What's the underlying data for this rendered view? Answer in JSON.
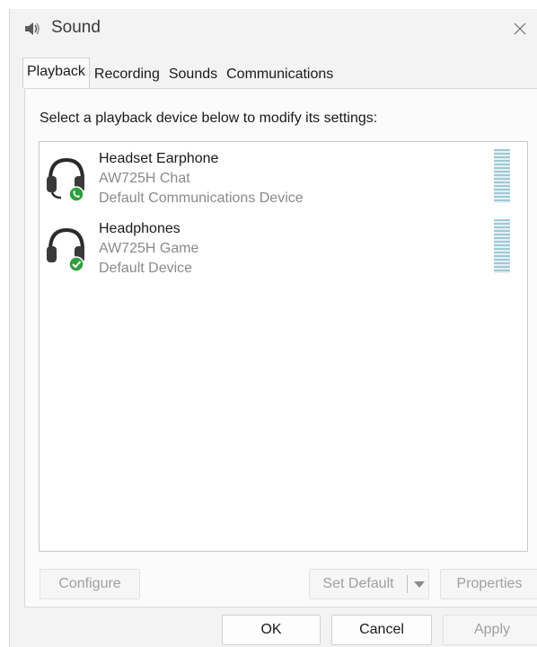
{
  "window": {
    "title": "Sound",
    "icon": "speaker-icon",
    "close_icon": "close-icon"
  },
  "tabs": [
    {
      "label": "Playback",
      "active": true
    },
    {
      "label": "Recording",
      "active": false
    },
    {
      "label": "Sounds",
      "active": false
    },
    {
      "label": "Communications",
      "active": false
    }
  ],
  "playback": {
    "instruction": "Select a playback device below to modify its settings:",
    "devices": [
      {
        "name": "Headset Earphone",
        "description": "AW725H Chat",
        "status": "Default Communications Device",
        "icon": "headset-icon",
        "badge": "phone-icon",
        "badge_color": "#2e9e3e"
      },
      {
        "name": "Headphones",
        "description": "AW725H Game",
        "status": "Default Device",
        "icon": "headphones-icon",
        "badge": "check-icon",
        "badge_color": "#2e9e3e"
      }
    ]
  },
  "panel_buttons": {
    "configure": "Configure",
    "set_default": "Set Default",
    "properties": "Properties"
  },
  "dialog_buttons": {
    "ok": "OK",
    "cancel": "Cancel",
    "apply": "Apply"
  }
}
